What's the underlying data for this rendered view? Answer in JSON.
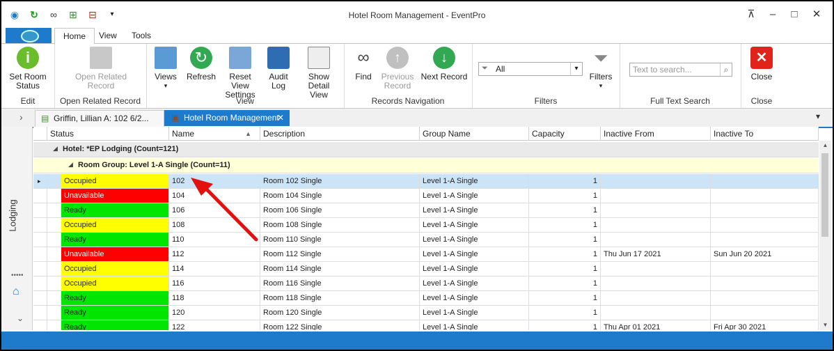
{
  "window": {
    "title": "Hotel Room Management - EventPro"
  },
  "ribbon_tabs": [
    "Home",
    "View",
    "Tools"
  ],
  "ribbon": {
    "edit": {
      "label": "Edit",
      "set_room_status": "Set Room\nStatus"
    },
    "open_related": {
      "label": "Open Related Record",
      "button": "Open Related\nRecord"
    },
    "view": {
      "label": "View",
      "views": "Views",
      "refresh": "Refresh",
      "reset": "Reset View\nSettings",
      "audit": "Audit\nLog",
      "detail": "Show Detail\nView"
    },
    "nav": {
      "label": "Records Navigation",
      "find": "Find",
      "previous": "Previous\nRecord",
      "next": "Next Record"
    },
    "filters": {
      "label": "Filters",
      "combo_value": "All",
      "button": "Filters"
    },
    "fts": {
      "label": "Full Text Search",
      "placeholder": "Text to search..."
    },
    "close": {
      "label": "Close",
      "button": "Close"
    }
  },
  "doc_tabs": [
    {
      "label": "Griffin, Lillian A: 102 6/2..."
    },
    {
      "label": "Hotel Room Management"
    }
  ],
  "left_panel": {
    "label": "Lodging"
  },
  "grid": {
    "columns": [
      "Status",
      "Name",
      "Description",
      "Group Name",
      "Capacity",
      "Inactive From",
      "Inactive To"
    ],
    "group_hotel": "Hotel: *EP Lodging (Count=121)",
    "group_room": "Room Group: Level 1-A Single (Count=11)",
    "rows": [
      {
        "status": "Occupied",
        "name": "102",
        "desc": "Room 102 Single",
        "group": "Level 1-A Single",
        "cap": "1",
        "from": "",
        "to": ""
      },
      {
        "status": "Unavailable",
        "name": "104",
        "desc": "Room 104 Single",
        "group": "Level 1-A Single",
        "cap": "1",
        "from": "",
        "to": ""
      },
      {
        "status": "Ready",
        "name": "106",
        "desc": "Room 106 Single",
        "group": "Level 1-A Single",
        "cap": "1",
        "from": "",
        "to": ""
      },
      {
        "status": "Occupied",
        "name": "108",
        "desc": "Room 108 Single",
        "group": "Level 1-A Single",
        "cap": "1",
        "from": "",
        "to": ""
      },
      {
        "status": "Ready",
        "name": "110",
        "desc": "Room 110 Single",
        "group": "Level 1-A Single",
        "cap": "1",
        "from": "",
        "to": ""
      },
      {
        "status": "Unavailable",
        "name": "112",
        "desc": "Room 112 Single",
        "group": "Level 1-A Single",
        "cap": "1",
        "from": "Thu Jun 17 2021",
        "to": "Sun Jun 20 2021"
      },
      {
        "status": "Occupied",
        "name": "114",
        "desc": "Room 114 Single",
        "group": "Level 1-A Single",
        "cap": "1",
        "from": "",
        "to": ""
      },
      {
        "status": "Occupied",
        "name": "116",
        "desc": "Room 116 Single",
        "group": "Level 1-A Single",
        "cap": "1",
        "from": "",
        "to": ""
      },
      {
        "status": "Ready",
        "name": "118",
        "desc": "Room 118 Single",
        "group": "Level 1-A Single",
        "cap": "1",
        "from": "",
        "to": ""
      },
      {
        "status": "Ready",
        "name": "120",
        "desc": "Room 120 Single",
        "group": "Level 1-A Single",
        "cap": "1",
        "from": "",
        "to": ""
      },
      {
        "status": "Ready",
        "name": "122",
        "desc": "Room 122 Single",
        "group": "Level 1-A Single",
        "cap": "1",
        "from": "Thu Apr 01 2021",
        "to": "Fri Apr 30 2021"
      }
    ]
  },
  "colors": {
    "occupied": "#ffff00",
    "unavailable": "#ff0000",
    "ready": "#00e600",
    "accent": "#1e7bcb",
    "selected_row": "#cce4f7",
    "group_band": "#ffffd8"
  }
}
